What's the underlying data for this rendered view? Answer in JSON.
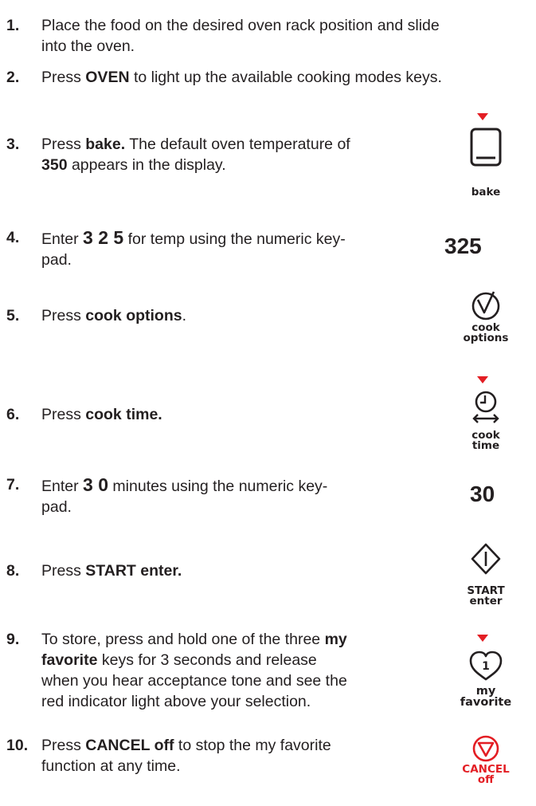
{
  "steps": [
    {
      "num": "1.",
      "line1": "Place the food on the desired oven rack position and slide",
      "line2": "into the oven."
    },
    {
      "num": "2.",
      "pre": "Press ",
      "bold": "OVEN",
      "post": " to light up the available cooking modes keys."
    },
    {
      "num": "3.",
      "pre": "Press ",
      "bold": "bake.",
      "post": " The default oven temperature of",
      "line2_bold": "350",
      "line2_post": " appears in the display."
    },
    {
      "num": "4.",
      "pre": "Enter ",
      "big": "3 2 5",
      "post": " for temp using the numeric key-",
      "line2": "pad."
    },
    {
      "num": "5.",
      "pre": "Press ",
      "bold": "cook options",
      "post": "."
    },
    {
      "num": "6.",
      "pre": "Press ",
      "bold": "cook time."
    },
    {
      "num": "7.",
      "pre": "Enter ",
      "big": "3 0",
      "post": " minutes using the numeric key-",
      "line2": "pad."
    },
    {
      "num": "8.",
      "pre": "Press ",
      "bold": "START enter."
    },
    {
      "num": "9.",
      "pre": "To store, press and hold one of the three ",
      "bold": "my",
      "line2_bold": "favorite",
      "line2_post": " keys for 3 seconds and release",
      "line3": "when you hear acceptance tone and see the",
      "line4": "red indicator light above your selection."
    },
    {
      "num": "10.",
      "pre": "Press ",
      "bold": "CANCEL off",
      "post": " to stop the my favorite",
      "line2": "function at any time."
    }
  ],
  "keys": {
    "bake": {
      "label": "bake",
      "icon": "bake-square-icon"
    },
    "temp_value": "325",
    "cook_options": {
      "line1": "cook",
      "line2": "options",
      "icon": "checkmark-circle-icon"
    },
    "cook_time": {
      "line1": "cook",
      "line2": "time",
      "icon": "clock-arrow-icon"
    },
    "time_value": "30",
    "start": {
      "line1": "START",
      "line2": "enter",
      "icon": "start-diamond-icon"
    },
    "favorite": {
      "line1": "my",
      "line2": "favorite",
      "digit": "1",
      "icon": "heart-1-icon"
    },
    "cancel": {
      "line1": "CANCEL",
      "line2": "off",
      "icon": "cancel-triangle-icon"
    }
  },
  "colors": {
    "accent_red": "#e31e24",
    "text": "#231f20"
  }
}
